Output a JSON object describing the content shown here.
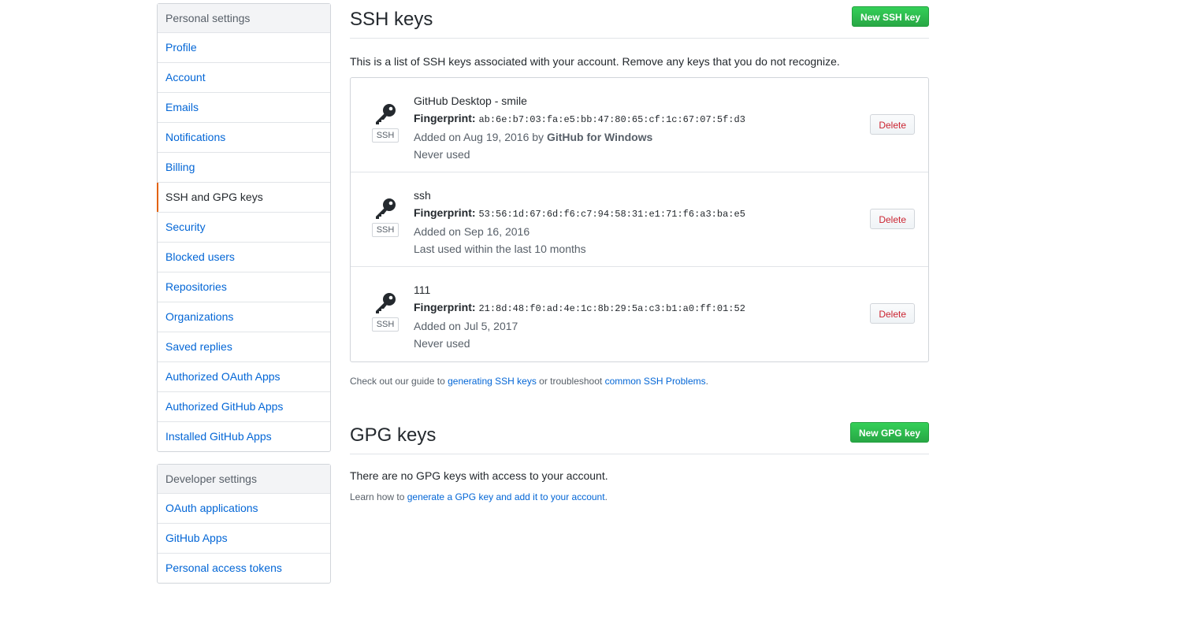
{
  "sidebar": {
    "personal_heading": "Personal settings",
    "personal_items": [
      {
        "label": "Profile"
      },
      {
        "label": "Account"
      },
      {
        "label": "Emails"
      },
      {
        "label": "Notifications"
      },
      {
        "label": "Billing"
      },
      {
        "label": "SSH and GPG keys",
        "selected": true
      },
      {
        "label": "Security"
      },
      {
        "label": "Blocked users"
      },
      {
        "label": "Repositories"
      },
      {
        "label": "Organizations"
      },
      {
        "label": "Saved replies"
      },
      {
        "label": "Authorized OAuth Apps"
      },
      {
        "label": "Authorized GitHub Apps"
      },
      {
        "label": "Installed GitHub Apps"
      }
    ],
    "developer_heading": "Developer settings",
    "developer_items": [
      {
        "label": "OAuth applications"
      },
      {
        "label": "GitHub Apps"
      },
      {
        "label": "Personal access tokens"
      }
    ]
  },
  "ssh": {
    "title": "SSH keys",
    "new_button": "New SSH key",
    "intro": "This is a list of SSH keys associated with your account. Remove any keys that you do not recognize.",
    "badge": "SSH",
    "fingerprint_label": "Fingerprint:",
    "delete_label": "Delete",
    "keys": [
      {
        "title": "GitHub Desktop - smile",
        "fingerprint": "ab:6e:b7:03:fa:e5:bb:47:80:65:cf:1c:67:07:5f:d3",
        "added": "Added on Aug 19, 2016 by",
        "added_by": "GitHub for Windows",
        "usage": "Never used"
      },
      {
        "title": "ssh",
        "fingerprint": "53:56:1d:67:6d:f6:c7:94:58:31:e1:71:f6:a3:ba:e5",
        "added": "Added on Sep 16, 2016",
        "added_by": "",
        "usage": "Last used within the last 10 months"
      },
      {
        "title": "111",
        "fingerprint": "21:8d:48:f0:ad:4e:1c:8b:29:5a:c3:b1:a0:ff:01:52",
        "added": "Added on Jul 5, 2017",
        "added_by": "",
        "usage": "Never used"
      }
    ],
    "help_prefix": "Check out our guide to",
    "help_link1": "generating SSH keys",
    "help_middle": "or troubleshoot",
    "help_link2": "common SSH Problems",
    "help_suffix": "."
  },
  "gpg": {
    "title": "GPG keys",
    "new_button": "New GPG key",
    "empty_text": "There are no GPG keys with access to your account.",
    "help_prefix": "Learn how to",
    "help_link": "generate a GPG key and add it to your account",
    "help_suffix": "."
  },
  "colors": {
    "link": "#0366d6",
    "primary_button": "#28a745",
    "danger_text": "#cb2431",
    "selected_marker": "#e36209"
  }
}
